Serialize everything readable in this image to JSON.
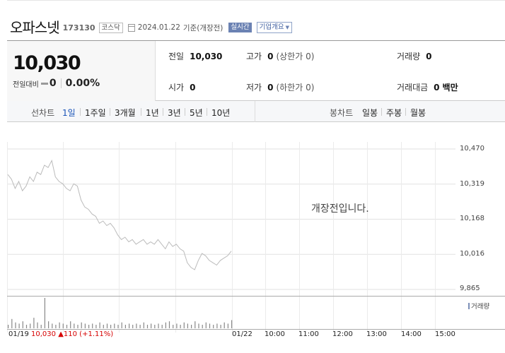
{
  "header": {
    "name": "오파스넷",
    "code": "173130",
    "market": "코스닥",
    "date": "2024.01.22",
    "basis": "기준(개장전)",
    "realtime_label": "실시간",
    "overview_label": "기업개요"
  },
  "quote": {
    "price": "10,030",
    "change_label": "전일대비",
    "change": "0",
    "change_pct": "0.00%",
    "prev_close_label": "전일",
    "prev_close": "10,030",
    "high_label": "고가",
    "high": "0",
    "upper_limit_label": "상한가",
    "upper_limit": "0",
    "volume_label": "거래량",
    "volume": "0",
    "open_label": "시가",
    "open": "0",
    "low_label": "저가",
    "low": "0",
    "lower_limit_label": "하한가",
    "lower_limit": "0",
    "turnover_label": "거래대금",
    "turnover": "0",
    "turnover_unit": "백만"
  },
  "tabs": {
    "line_chart_label": "선차트",
    "periods": [
      "1일",
      "1주일",
      "3개월",
      "1년",
      "3년",
      "5년",
      "10년"
    ],
    "active_period": "1일",
    "candle_chart_label": "봉차트",
    "candles": [
      "일봉",
      "주봉",
      "월봉"
    ]
  },
  "chart_data": {
    "type": "line",
    "y_ticks": [
      "10,470",
      "10,319",
      "10,168",
      "10,016",
      "9,865"
    ],
    "ylim": [
      9865,
      10470
    ],
    "x_ticks": [
      "01/22",
      "10:00",
      "11:00",
      "12:00",
      "13:00",
      "14:00",
      "15:00"
    ],
    "message": "개장전입니다.",
    "volume_legend": "거래량",
    "series_color": "#bbbbbb",
    "volume_color": "#888888",
    "last_session": {
      "date": "01/19",
      "price": "10,030",
      "change": "▲110",
      "change_pct": "(+1.11%)"
    },
    "intraday_values": [
      10360,
      10340,
      10300,
      10330,
      10290,
      10310,
      10350,
      10330,
      10370,
      10360,
      10400,
      10390,
      10420,
      10350,
      10330,
      10320,
      10300,
      10290,
      10320,
      10310,
      10250,
      10220,
      10210,
      10190,
      10180,
      10150,
      10160,
      10140,
      10150,
      10130,
      10100,
      10080,
      10090,
      10070,
      10080,
      10060,
      10070,
      10080,
      10060,
      10070,
      10060,
      10080,
      10060,
      10040,
      10070,
      10050,
      10060,
      10040,
      10030,
      9980,
      9960,
      9950,
      9990,
      10020,
      10010,
      9990,
      9980,
      9970,
      9990,
      10000,
      10010,
      10030
    ],
    "volume_values": [
      3,
      8,
      5,
      4,
      6,
      3,
      4,
      9,
      5,
      3,
      26,
      6,
      4,
      3,
      5,
      4,
      3,
      6,
      4,
      3,
      5,
      4,
      3,
      4,
      3,
      5,
      3,
      4,
      3,
      4,
      3,
      5,
      3,
      4,
      3,
      4,
      3,
      5,
      3,
      4,
      3,
      4,
      3,
      5,
      6,
      3,
      4,
      3,
      5,
      4,
      3,
      6,
      4,
      3,
      5,
      4,
      3,
      4,
      3,
      5,
      4,
      7
    ]
  }
}
